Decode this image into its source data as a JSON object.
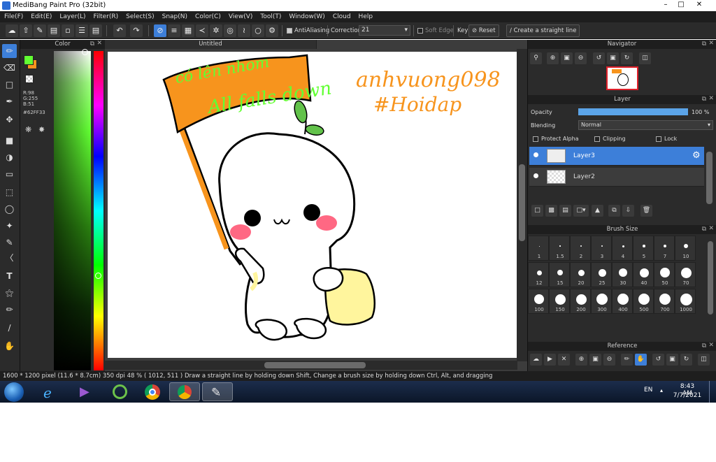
{
  "window": {
    "title": "MediBang Paint Pro (32bit)"
  },
  "menu": [
    "File(F)",
    "Edit(E)",
    "Layer(L)",
    "Filter(R)",
    "Select(S)",
    "Snap(N)",
    "Color(C)",
    "View(V)",
    "Tool(T)",
    "Window(W)",
    "Cloud",
    "Help"
  ],
  "toolbar": {
    "antialiasing": "AntiAliasing",
    "correction_label": "Correction",
    "correction_value": "21",
    "soft_edge": "Soft Edge",
    "key_label": "Key",
    "reset": "Reset",
    "straight_line": "Create a straight line"
  },
  "color_panel": {
    "title": "Color",
    "main_color": "#62FF33",
    "sub_color": "#F7941D",
    "rgb_r": "R:98",
    "rgb_g": "G:255",
    "rgb_b": "B:51",
    "hex": "#62FF33"
  },
  "document": {
    "tab": "Untitled"
  },
  "drawing_text": {
    "flag_line1": "có lên nhom",
    "flag_line2": "All falls down",
    "sig1": "anhvuong098",
    "sig2": "#Hoidap"
  },
  "navigator": {
    "title": "Navigator"
  },
  "layer_panel": {
    "title": "Layer",
    "opacity_label": "Opacity",
    "opacity_value": "100 %",
    "opacity_fraction": 1.0,
    "blending_label": "Blending",
    "blending_value": "Normal",
    "protect_alpha": "Protect Alpha",
    "clipping": "Clipping",
    "lock": "Lock",
    "layers": [
      {
        "name": "Layer3",
        "selected": true
      },
      {
        "name": "Layer2",
        "selected": false
      }
    ]
  },
  "brush_size": {
    "title": "Brush Size",
    "sizes": [
      "1",
      "1.5",
      "2",
      "3",
      "4",
      "5",
      "7",
      "10",
      "12",
      "15",
      "20",
      "25",
      "30",
      "40",
      "50",
      "70",
      "100",
      "150",
      "200",
      "300",
      "400",
      "500",
      "700",
      "1000"
    ]
  },
  "reference": {
    "title": "Reference"
  },
  "status": {
    "size": "1600 * 1200 pixel",
    "cm": "(11.6 * 8.7cm)",
    "dpi": "350 dpi",
    "zoom": "48 %",
    "cursor": "( 1012, 511 )",
    "hint": "Draw a straight line by holding down Shift, Change a brush size by holding down Ctrl, Alt, and dragging"
  },
  "taskbar": {
    "lang": "EN",
    "time": "8:43 AM",
    "date": "7/7/2021"
  }
}
